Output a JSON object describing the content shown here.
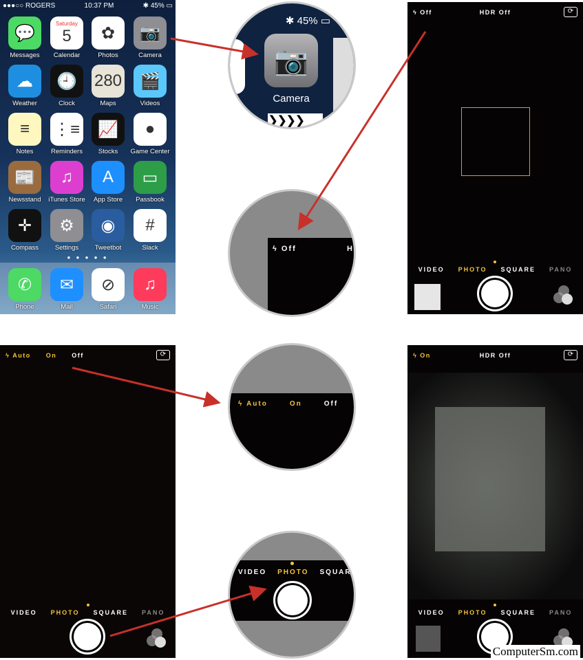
{
  "home": {
    "status": {
      "carrier": "●●●○○ ROGERS",
      "time": "10:37 PM",
      "battery": "45%"
    },
    "apps": [
      {
        "label": "Messages",
        "color": "#4cd964",
        "glyph": "💬"
      },
      {
        "label": "Calendar",
        "color": "#ffffff",
        "glyph": "5",
        "sub": "Saturday"
      },
      {
        "label": "Photos",
        "color": "#ffffff",
        "glyph": "✿"
      },
      {
        "label": "Camera",
        "color": "#8e8e93",
        "glyph": "📷"
      },
      {
        "label": "Weather",
        "color": "#1e8fe0",
        "glyph": "☁"
      },
      {
        "label": "Clock",
        "color": "#111111",
        "glyph": "🕘"
      },
      {
        "label": "Maps",
        "color": "#e8e4d8",
        "glyph": "280"
      },
      {
        "label": "Videos",
        "color": "#5ac8fa",
        "glyph": "🎬"
      },
      {
        "label": "Notes",
        "color": "#fff7c0",
        "glyph": "≡"
      },
      {
        "label": "Reminders",
        "color": "#ffffff",
        "glyph": "⋮≡"
      },
      {
        "label": "Stocks",
        "color": "#111111",
        "glyph": "📈"
      },
      {
        "label": "Game Center",
        "color": "#ffffff",
        "glyph": "●"
      },
      {
        "label": "Newsstand",
        "color": "#9a6b3f",
        "glyph": "📰"
      },
      {
        "label": "iTunes Store",
        "color": "#dc3fd0",
        "glyph": "♫"
      },
      {
        "label": "App Store",
        "color": "#1e8fff",
        "glyph": "A"
      },
      {
        "label": "Passbook",
        "color": "#2d9d48",
        "glyph": "▭"
      },
      {
        "label": "Compass",
        "color": "#111111",
        "glyph": "✛"
      },
      {
        "label": "Settings",
        "color": "#8e8e93",
        "glyph": "⚙"
      },
      {
        "label": "Tweetbot",
        "color": "#2a5d9f",
        "glyph": "◉"
      },
      {
        "label": "Slack",
        "color": "#ffffff",
        "glyph": "#"
      }
    ],
    "dock": [
      {
        "label": "Phone",
        "color": "#4cd964",
        "glyph": "✆"
      },
      {
        "label": "Mail",
        "color": "#1e8fff",
        "glyph": "✉"
      },
      {
        "label": "Safari",
        "color": "#ffffff",
        "glyph": "⊘"
      },
      {
        "label": "Music",
        "color": "#ff3b5c",
        "glyph": "♫"
      }
    ],
    "page_dots": "● ● ● ● ●"
  },
  "zoom1": {
    "battery": "45%",
    "label": "Camera"
  },
  "camera1": {
    "flash": "Off",
    "hdr": "HDR Off",
    "modes": [
      "VIDEO",
      "PHOTO",
      "SQUARE",
      "PANO"
    ],
    "active_mode": "PHOTO"
  },
  "zoom2": {
    "flash": "Off",
    "partial": "H"
  },
  "camera2": {
    "flash_options": [
      "Auto",
      "On",
      "Off"
    ],
    "modes": [
      "VIDEO",
      "PHOTO",
      "SQUARE",
      "PANO"
    ]
  },
  "zoom3": {
    "flash_options": [
      "Auto",
      "On",
      "Off"
    ]
  },
  "zoom4": {
    "modes": [
      "VIDEO",
      "PHOTO",
      "SQUARE"
    ]
  },
  "camera3": {
    "flash": "On",
    "hdr": "HDR Off",
    "modes": [
      "VIDEO",
      "PHOTO",
      "SQUARE",
      "PANO"
    ]
  },
  "watermark": "ComputerSm.com",
  "colors": {
    "arrow": "#c8312a",
    "accent": "#f6c53a"
  }
}
